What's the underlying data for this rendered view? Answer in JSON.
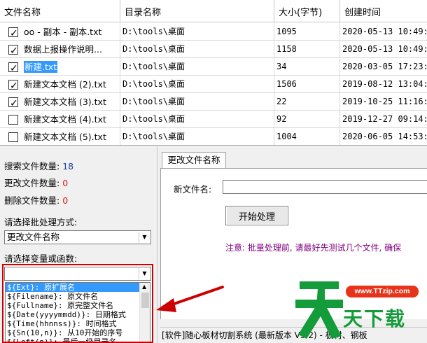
{
  "table": {
    "headers": [
      "文件名称",
      "目录名称",
      "大小(字节)",
      "创建时间"
    ],
    "rows": [
      {
        "checked": true,
        "name": "oo - 副本 - 副本.txt",
        "dir": "D:\\tools\\桌面",
        "size": "1095",
        "time": "2020-05-13 10:49:4",
        "selected": false
      },
      {
        "checked": true,
        "name": "数据上报操作说明...",
        "dir": "D:\\tools\\桌面",
        "size": "1158",
        "time": "2020-05-13 10:49:1",
        "selected": false
      },
      {
        "checked": true,
        "name": "新建.txt",
        "dir": "D:\\tools\\桌面",
        "size": "34",
        "time": "2020-03-05 17:23:0",
        "selected": true
      },
      {
        "checked": true,
        "name": "新建文本文档 (2).txt",
        "dir": "D:\\tools\\桌面",
        "size": "1506",
        "time": "2019-08-12 13:04:2",
        "selected": false
      },
      {
        "checked": true,
        "name": "新建文本文档 (3).txt",
        "dir": "D:\\tools\\桌面",
        "size": "22",
        "time": "2019-10-25 11:16:4",
        "selected": false
      },
      {
        "checked": false,
        "name": "新建文本文档 (4).txt",
        "dir": "D:\\tools\\桌面",
        "size": "92",
        "time": "2019-12-27 09:14:5",
        "selected": false
      },
      {
        "checked": false,
        "name": "新建文本文档 (5).txt",
        "dir": "D:\\tools\\桌面",
        "size": "1004",
        "time": "2020-06-05 14:53:5",
        "selected": false
      }
    ]
  },
  "stats": {
    "search_label": "搜索文件数量:",
    "search_value": "18",
    "changed_label": "更改文件数量:",
    "changed_value": "0",
    "deleted_label": "删除文件数量:",
    "deleted_value": "0"
  },
  "batch": {
    "label": "请选择批处理方式:",
    "selected": "更改文件名称"
  },
  "variable": {
    "label": "请选择变量或函数:",
    "selected": "",
    "options": [
      "${Ext}: 原扩展名",
      "${Filename}: 原文件名",
      "${Fullname}: 原完整文件名",
      "${Date(yyyymmdd)}: 日期格式",
      "${Time(hhnnss)}: 时间格式",
      "${Sn(10,n)}: 从10开始的序号",
      "${Left(n)}: 最后一级目录名"
    ],
    "selected_index": 0
  },
  "right": {
    "tab_label": "更改文件名称",
    "new_name_label": "新文件名:",
    "new_name_value": "",
    "start_button": "开始处理",
    "note": "注意: 批量处理前, 请最好先测试几个文件, 确保",
    "status": "[软件]随心板材切割系统 (最新版本 V3.2) - 板材、钢板"
  },
  "watermark": {
    "url": "www.TTzip.com",
    "slogan": "天下载"
  },
  "colors": {
    "selection": "#3399ff",
    "stat_blue": "#1f3fa8",
    "stat_red": "#d01818",
    "note_purple": "#800080",
    "annotation_red": "#cc0000",
    "watermark_green": "#149c3b"
  }
}
